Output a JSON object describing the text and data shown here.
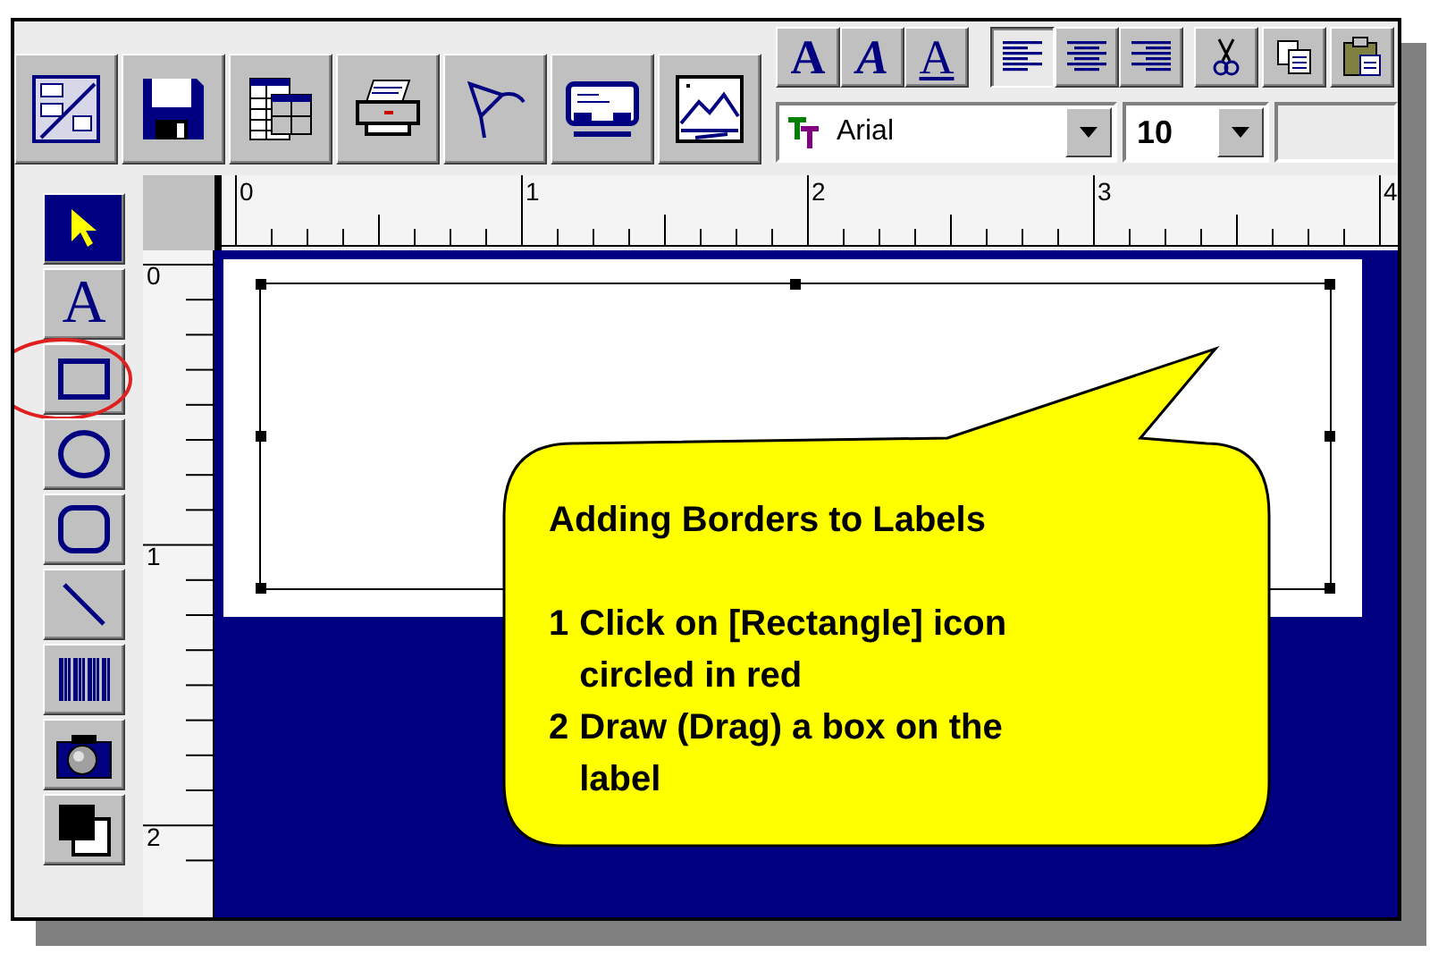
{
  "format_buttons": [
    {
      "kind": "bold",
      "label": "A"
    },
    {
      "kind": "italic",
      "label": "A"
    },
    {
      "kind": "underline",
      "label": "A"
    }
  ],
  "align_buttons": [
    {
      "kind": "left",
      "selected": true
    },
    {
      "kind": "center",
      "selected": false
    },
    {
      "kind": "right",
      "selected": false
    }
  ],
  "font_field": {
    "value": "Arial"
  },
  "size_field": {
    "value": "10"
  },
  "ruler_horizontal": [
    "0",
    "1",
    "2",
    "3",
    "4"
  ],
  "ruler_vertical": [
    "0",
    "1",
    "2"
  ],
  "tools": [
    {
      "kind": "pointer",
      "selected": true,
      "circled": false
    },
    {
      "kind": "text",
      "label": "A",
      "selected": false,
      "circled": false
    },
    {
      "kind": "rectangle",
      "selected": false,
      "circled": true
    },
    {
      "kind": "ellipse",
      "selected": false,
      "circled": false
    },
    {
      "kind": "rounded-rectangle",
      "selected": false,
      "circled": false
    },
    {
      "kind": "line",
      "selected": false,
      "circled": false
    },
    {
      "kind": "barcode",
      "selected": false,
      "circled": false
    },
    {
      "kind": "camera",
      "selected": false,
      "circled": false
    },
    {
      "kind": "color",
      "selected": false,
      "circled": false
    }
  ],
  "callout": {
    "title": "Adding Borders to Labels",
    "steps": [
      {
        "number": "1",
        "text": "Click on [Rectangle] icon circled in red"
      },
      {
        "number": "2",
        "text": "Draw (Drag) a box on the label"
      }
    ]
  }
}
